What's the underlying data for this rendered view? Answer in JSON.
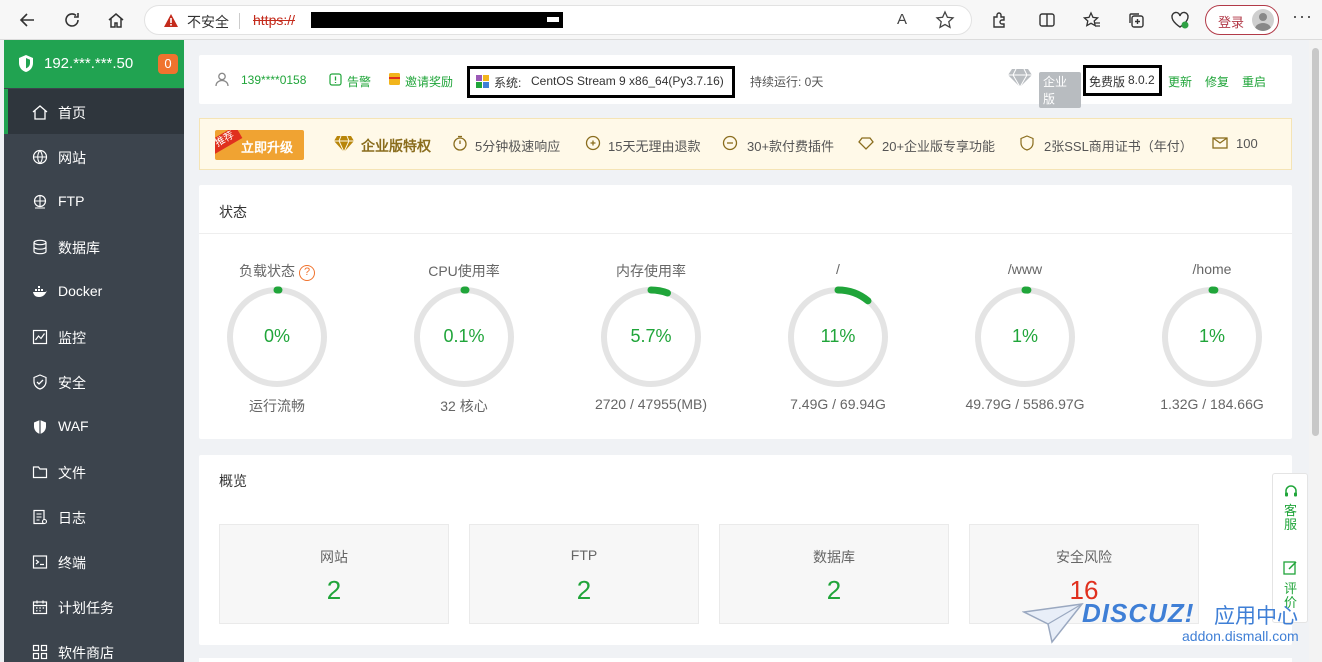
{
  "browser": {
    "insecure_label": "不安全",
    "url_prefix": "https://",
    "read_aloud": "A",
    "login_label": "登录",
    "more": "···"
  },
  "sidebar": {
    "server_ip": "192.***.***.50",
    "alert_count": "0",
    "items": [
      {
        "label": "首页",
        "icon": "home-icon"
      },
      {
        "label": "网站",
        "icon": "globe-icon"
      },
      {
        "label": "FTP",
        "icon": "ftp-icon"
      },
      {
        "label": "数据库",
        "icon": "database-icon"
      },
      {
        "label": "Docker",
        "icon": "docker-icon"
      },
      {
        "label": "监控",
        "icon": "monitor-icon"
      },
      {
        "label": "安全",
        "icon": "shield-check-icon"
      },
      {
        "label": "WAF",
        "icon": "waf-shield-icon"
      },
      {
        "label": "文件",
        "icon": "folder-icon"
      },
      {
        "label": "日志",
        "icon": "log-icon"
      },
      {
        "label": "终端",
        "icon": "terminal-icon"
      },
      {
        "label": "计划任务",
        "icon": "calendar-icon"
      },
      {
        "label": "软件商店",
        "icon": "apps-icon"
      }
    ]
  },
  "info_bar": {
    "user": "139****0158",
    "alarm": "告警",
    "invite": "邀请奖励",
    "system_label": "系统:",
    "system_value": "CentOS Stream 9 x86_64(Py3.7.16)",
    "uptime": "持续运行: 0天",
    "enterprise": "企业版",
    "edition": "免费版",
    "version": "8.0.2",
    "update": "更新",
    "repair": "修复",
    "restart": "重启"
  },
  "upgrade_bar": {
    "recommend": "推荐",
    "upgrade_now": "立即升级",
    "privilege": "企业版特权",
    "perks": [
      "5分钟极速响应",
      "15天无理由退款",
      "30+款付费插件",
      "20+企业版专享功能",
      "2张SSL商用证书（年付）",
      "100"
    ]
  },
  "status": {
    "title": "状态",
    "gauges": [
      {
        "title": "负载状态",
        "value": "0%",
        "fraction": 0.0,
        "sub": "运行流畅",
        "help": "?"
      },
      {
        "title": "CPU使用率",
        "value": "0.1%",
        "fraction": 0.001,
        "sub": "32 核心"
      },
      {
        "title": "内存使用率",
        "value": "5.7%",
        "fraction": 0.057,
        "sub": "2720 / 47955(MB)"
      },
      {
        "title": "/",
        "value": "11%",
        "fraction": 0.11,
        "sub": "7.49G / 69.94G"
      },
      {
        "title": "/www",
        "value": "1%",
        "fraction": 0.01,
        "sub": "49.79G / 5586.97G"
      },
      {
        "title": "/home",
        "value": "1%",
        "fraction": 0.01,
        "sub": "1.32G / 184.66G"
      }
    ]
  },
  "overview": {
    "title": "概览",
    "boxes": [
      {
        "label": "网站",
        "value": "2"
      },
      {
        "label": "FTP",
        "value": "2"
      },
      {
        "label": "数据库",
        "value": "2"
      },
      {
        "label": "安全风险",
        "value": "16"
      }
    ]
  },
  "float_tool": {
    "service": "客服",
    "review": "评价"
  },
  "watermark": {
    "brand": "DISCUZ!",
    "brand_cn": "应用中心",
    "domain": "addon.dismall.com"
  },
  "colors": {
    "accent": "#20a53a",
    "sidebar": "#3c444d",
    "danger": "#e0301e",
    "track": "#e4e4e4"
  }
}
